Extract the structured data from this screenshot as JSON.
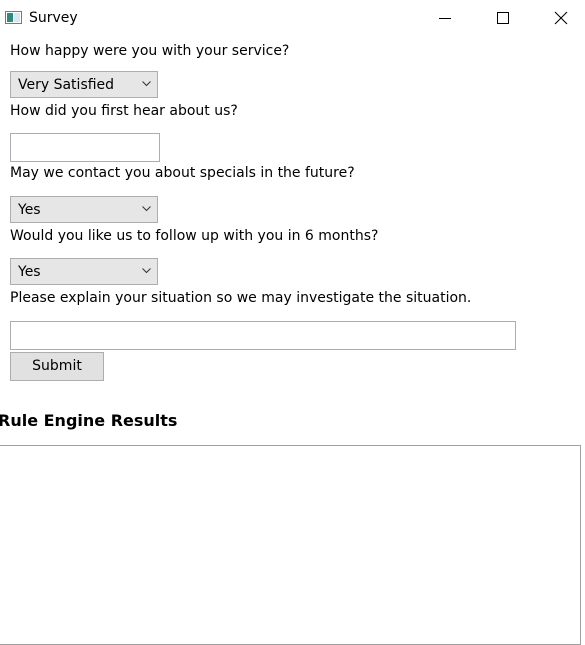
{
  "window": {
    "title": "Survey",
    "icon": "app-window-icon",
    "controls": [
      "minimize-icon",
      "maximize-icon",
      "close-icon"
    ]
  },
  "form": {
    "q1": {
      "label": "How happy were you with your service?",
      "selected": "Very Satisfied"
    },
    "q2": {
      "label": "How did you first hear about us?",
      "value": ""
    },
    "q3": {
      "label": "May we contact you about specials in the future?",
      "selected": "Yes"
    },
    "q4": {
      "label": "Would you like us to follow up with you in 6 months?",
      "selected": "Yes"
    },
    "q5": {
      "label": "Please explain your situation so we may investigate the situation.",
      "value": ""
    },
    "submit_label": "Submit"
  },
  "results": {
    "title": "Rule Engine Results",
    "content": ""
  }
}
